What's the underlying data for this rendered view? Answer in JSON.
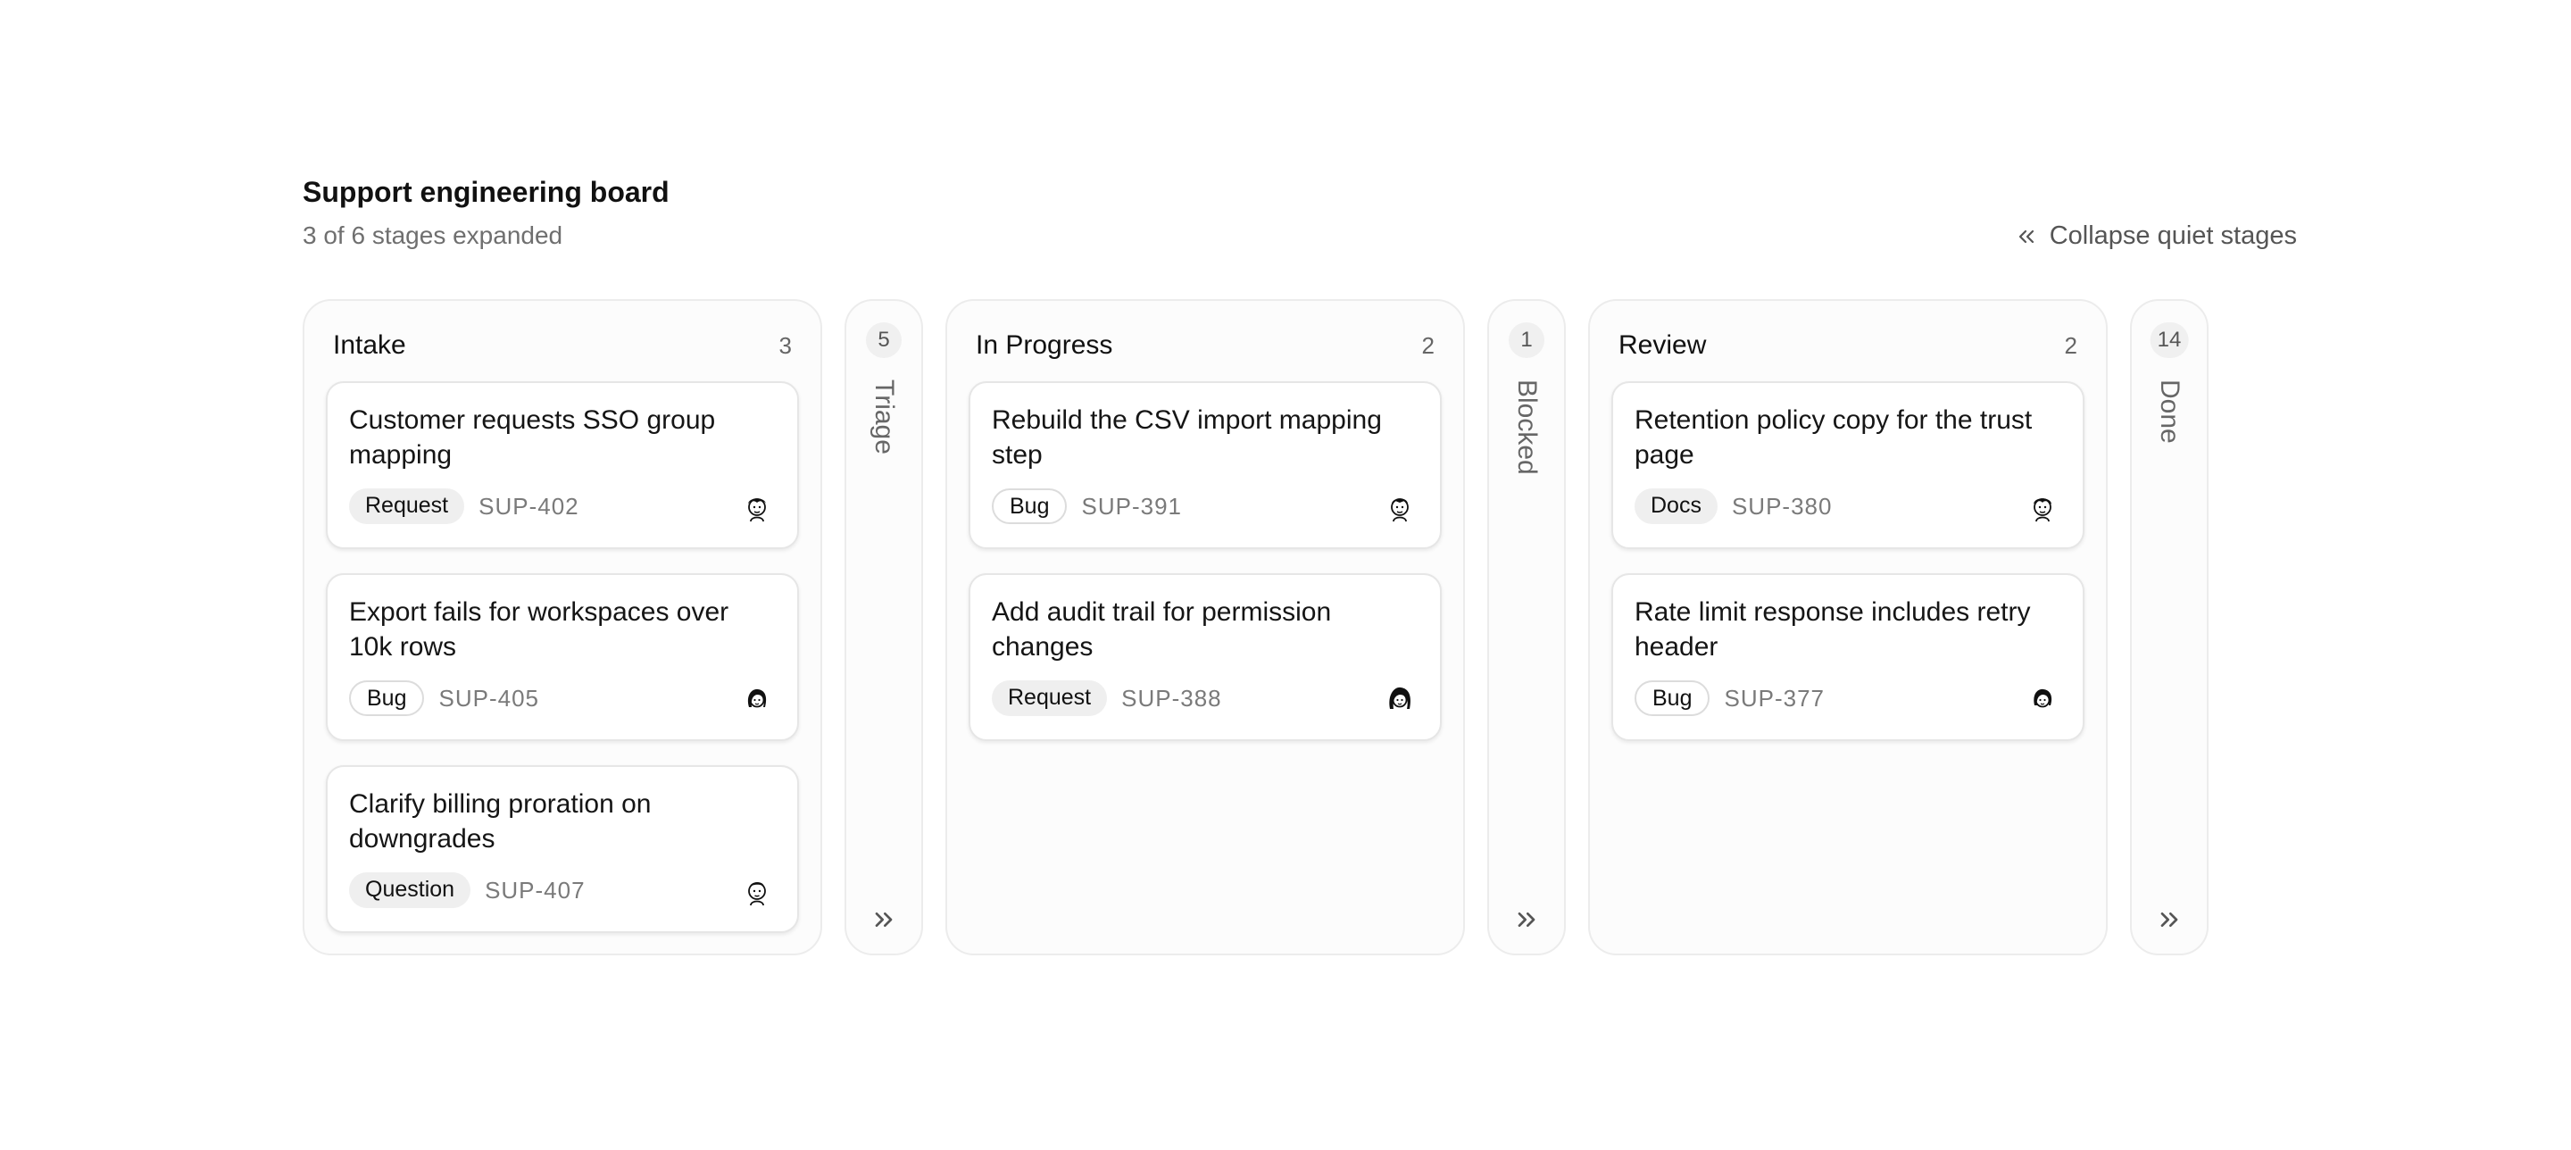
{
  "header": {
    "title": "Support engineering board",
    "subtitle": "3 of 6 stages expanded",
    "collapse_label": "Collapse quiet stages"
  },
  "stages": {
    "intake": {
      "title": "Intake",
      "count": "3",
      "cards": [
        {
          "title": "Customer requests SSO group mapping",
          "tag": "Request",
          "ticket": "SUP-402",
          "avatar": "avatar-icon"
        },
        {
          "title": "Export fails for workspaces over 10k rows",
          "tag": "Bug",
          "ticket": "SUP-405",
          "avatar": "avatar-icon"
        },
        {
          "title": "Clarify billing proration on downgrades",
          "tag": "Question",
          "ticket": "SUP-407",
          "avatar": "avatar-icon"
        }
      ]
    },
    "triage": {
      "title": "Triage",
      "count": "5"
    },
    "in_progress": {
      "title": "In Progress",
      "count": "2",
      "cards": [
        {
          "title": "Rebuild the CSV import mapping step",
          "tag": "Bug",
          "ticket": "SUP-391",
          "avatar": "avatar-icon"
        },
        {
          "title": "Add audit trail for permission changes",
          "tag": "Request",
          "ticket": "SUP-388",
          "avatar": "avatar-icon"
        }
      ]
    },
    "blocked": {
      "title": "Blocked",
      "count": "1"
    },
    "review": {
      "title": "Review",
      "count": "2",
      "cards": [
        {
          "title": "Retention policy copy for the trust page",
          "tag": "Docs",
          "ticket": "SUP-380",
          "avatar": "avatar-icon"
        },
        {
          "title": "Rate limit response includes retry header",
          "tag": "Bug",
          "ticket": "SUP-377",
          "avatar": "avatar-icon"
        }
      ]
    },
    "done": {
      "title": "Done",
      "count": "14"
    }
  },
  "colors": {
    "column_bg": "#fcfcfc",
    "column_border": "#ececec",
    "tag_fill": "#efefef",
    "muted_text": "#7a7a7a"
  }
}
